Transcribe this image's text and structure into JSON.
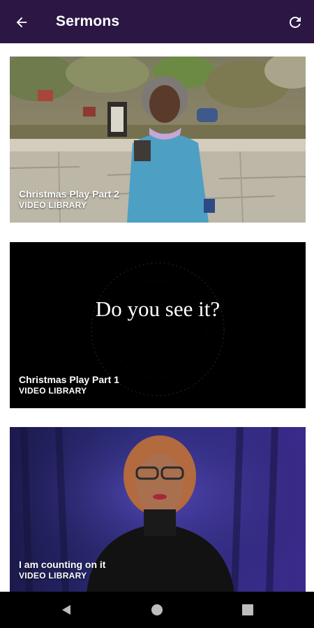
{
  "appbar": {
    "title": "Sermons",
    "back_icon": "arrow-left-icon",
    "refresh_icon": "refresh-icon",
    "background": "#2c1744"
  },
  "sermons": [
    {
      "title": "Christmas Play Part 2",
      "subtitle": "VIDEO LIBRARY"
    },
    {
      "title": "Christmas Play Part 1",
      "subtitle": "VIDEO LIBRARY",
      "overlay": "Do you see it?"
    },
    {
      "title": "I am counting on it",
      "subtitle": "VIDEO LIBRARY"
    }
  ],
  "navbar": {
    "back_icon": "triangle-back-icon",
    "home_icon": "circle-home-icon",
    "recents_icon": "square-recents-icon"
  }
}
